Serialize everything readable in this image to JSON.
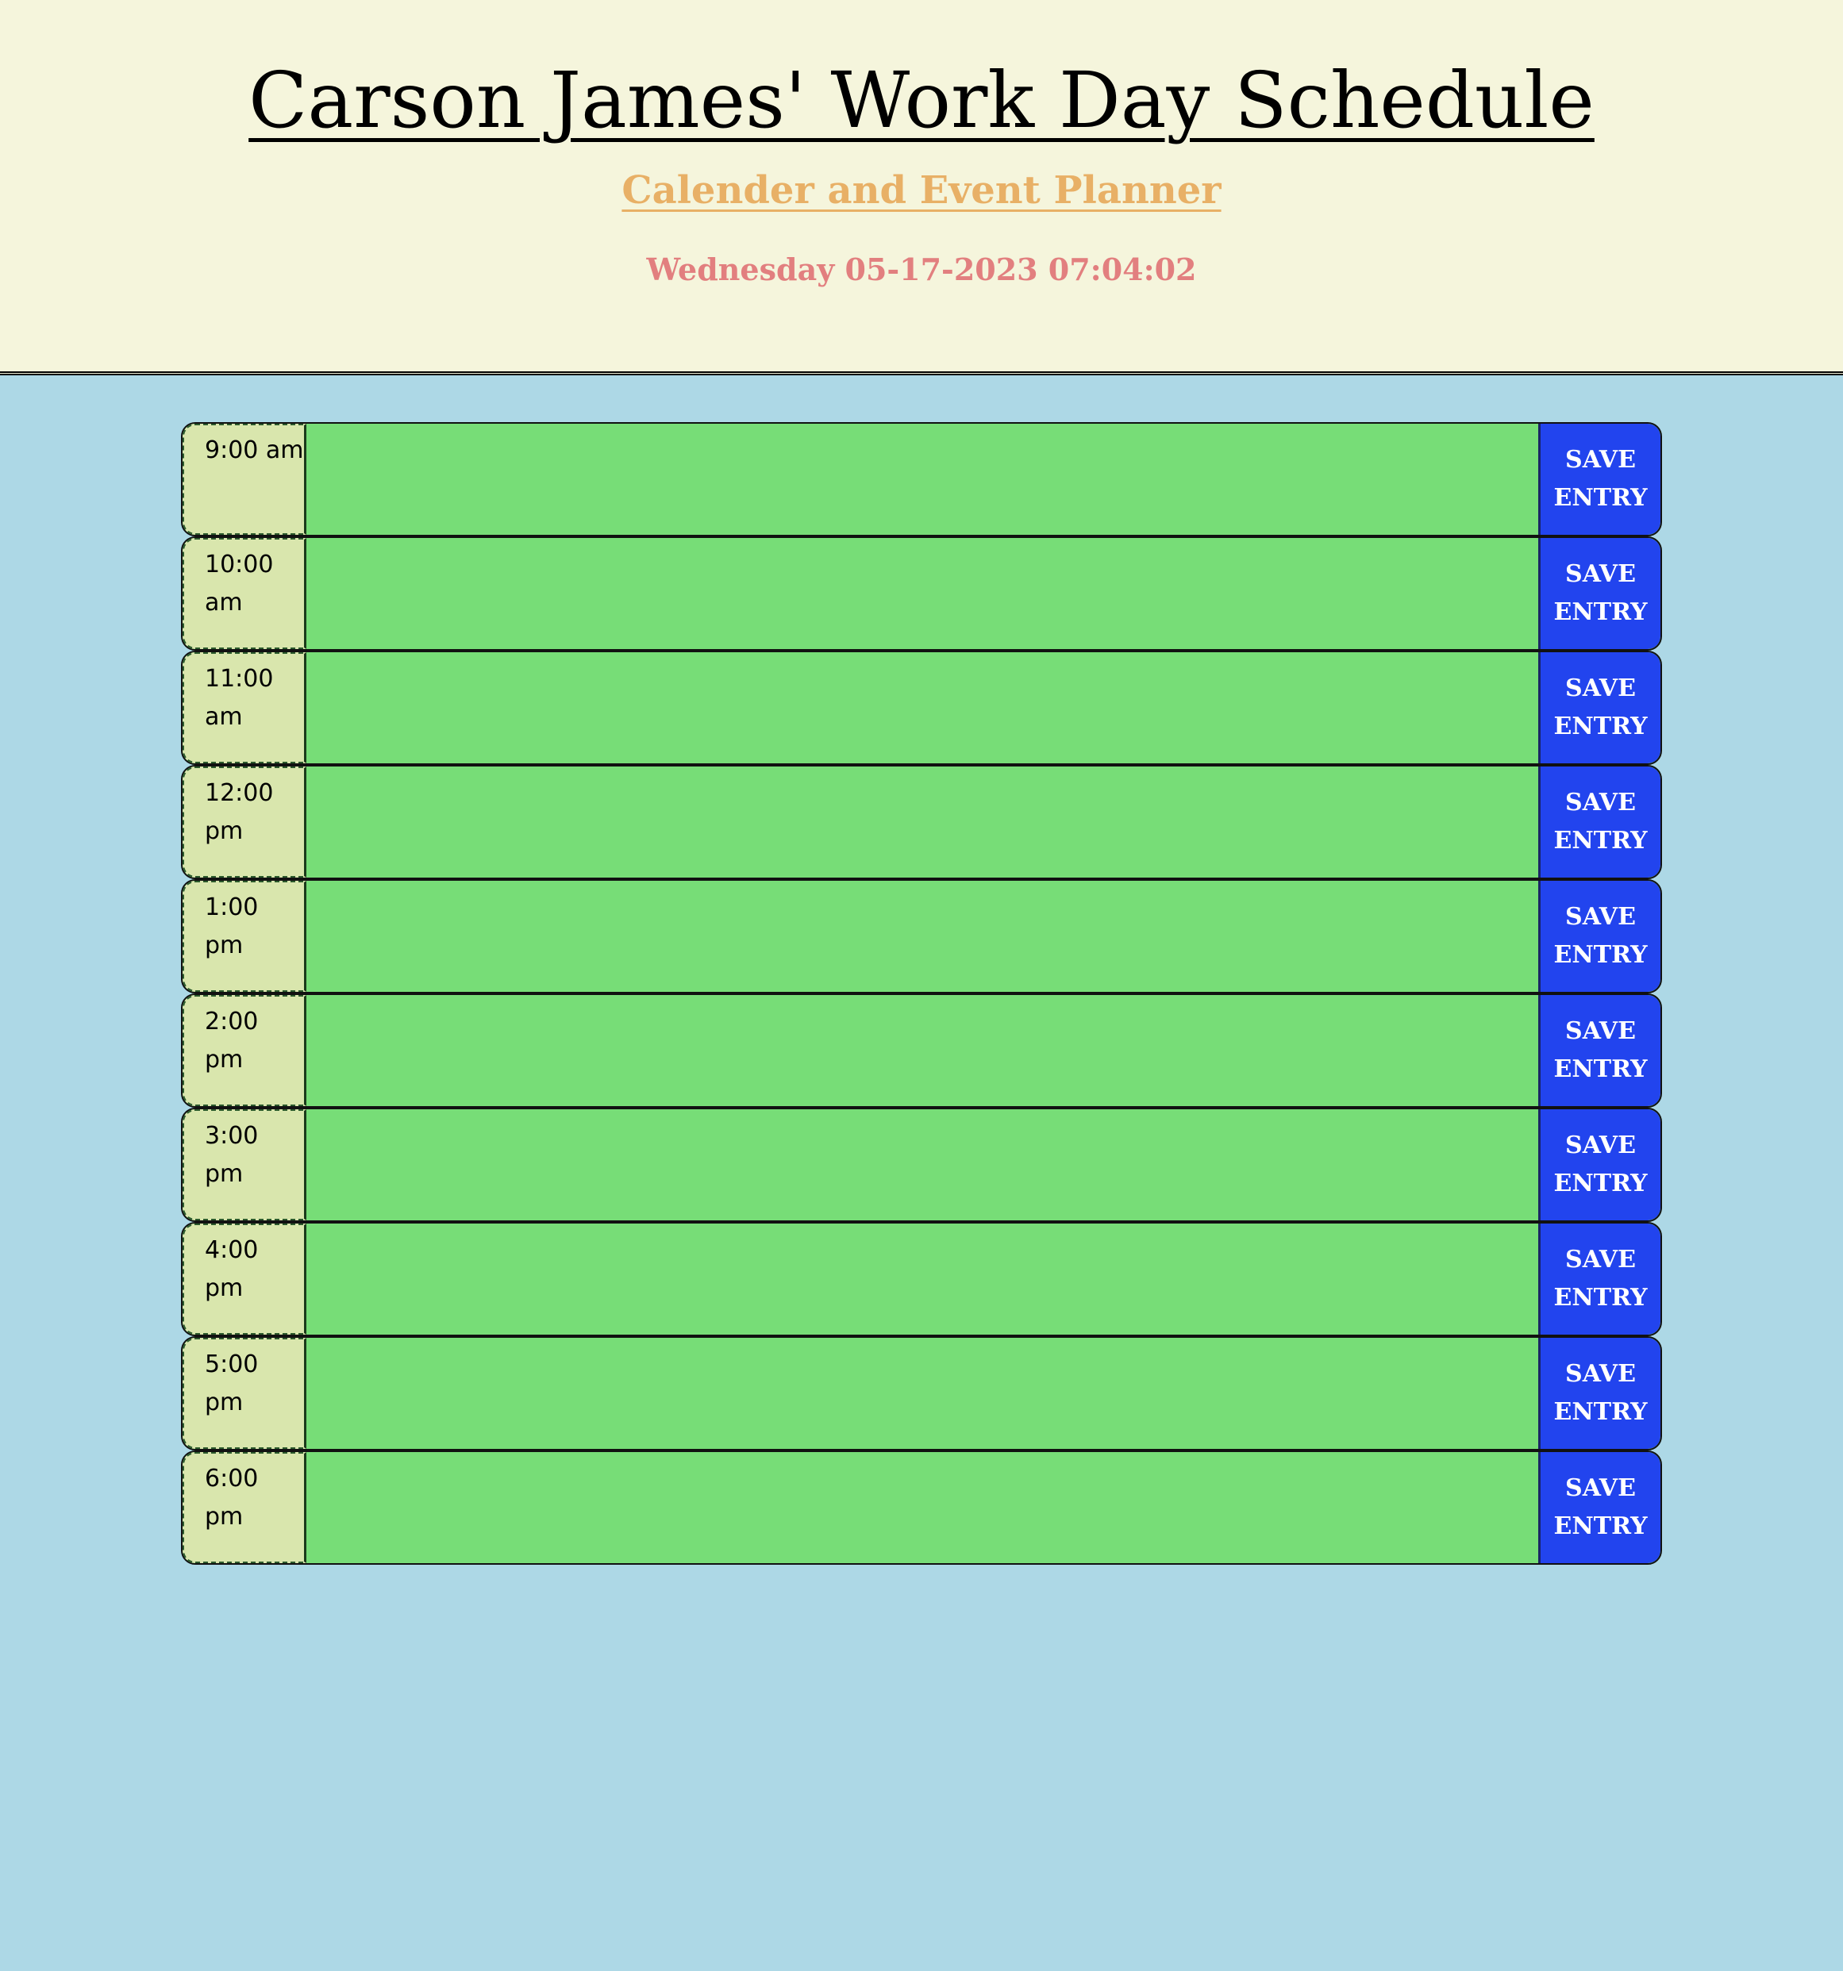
{
  "header": {
    "title": "Carson James' Work Day Schedule",
    "subtitle": "Calender and Event Planner",
    "datetime": "Wednesday 05-17-2023 07:04:02"
  },
  "schedule": {
    "save_label": "SAVE ENTRY",
    "rows": [
      {
        "hour": "9:00 am",
        "entry": ""
      },
      {
        "hour": "10:00 am",
        "entry": ""
      },
      {
        "hour": "11:00 am",
        "entry": ""
      },
      {
        "hour": "12:00 pm",
        "entry": ""
      },
      {
        "hour": "1:00 pm",
        "entry": ""
      },
      {
        "hour": "2:00 pm",
        "entry": ""
      },
      {
        "hour": "3:00 pm",
        "entry": ""
      },
      {
        "hour": "4:00 pm",
        "entry": ""
      },
      {
        "hour": "5:00 pm",
        "entry": ""
      },
      {
        "hour": "6:00 pm",
        "entry": ""
      }
    ]
  },
  "colors": {
    "header_background": "#f5f5dc",
    "page_background": "#add8e6",
    "subtitle": "#e8b066",
    "datetime": "#e27f7f",
    "hour_cell": "#d9e6ad",
    "future_row": "#77dd77",
    "save_button": "#2244ee"
  }
}
